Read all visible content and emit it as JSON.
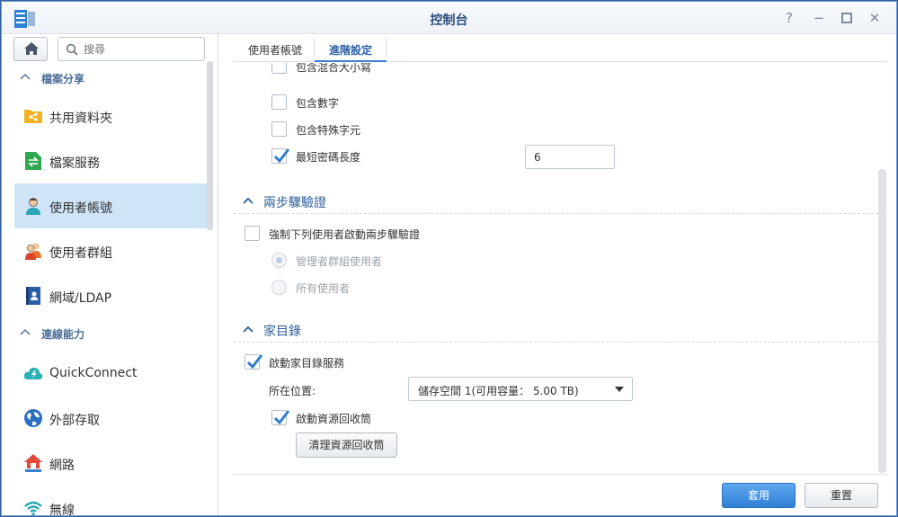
{
  "window": {
    "title": "控制台"
  },
  "controls": {
    "help": "?",
    "minimize": "−",
    "maximize": "□",
    "close": "✕"
  },
  "search": {
    "placeholder": "搜尋"
  },
  "sidebar": {
    "sections": [
      {
        "label": "檔案分享"
      },
      {
        "label": "連線能力"
      }
    ],
    "items": [
      {
        "label": "共用資料夾",
        "icon": "shared-folder-icon"
      },
      {
        "label": "檔案服務",
        "icon": "file-services-icon"
      },
      {
        "label": "使用者帳號",
        "icon": "user-icon"
      },
      {
        "label": "使用者群組",
        "icon": "group-icon"
      },
      {
        "label": "網域/LDAP",
        "icon": "domain-ldap-icon"
      },
      {
        "label": "QuickConnect",
        "icon": "quickconnect-icon"
      },
      {
        "label": "外部存取",
        "icon": "external-access-icon"
      },
      {
        "label": "網路",
        "icon": "network-icon"
      },
      {
        "label": "無線",
        "icon": "wireless-icon"
      }
    ],
    "active_item": "使用者帳號"
  },
  "tabs": [
    {
      "label": "使用者帳號"
    },
    {
      "label": "進階設定"
    }
  ],
  "active_tab": "進階設定",
  "password_rules": {
    "mixed_case": {
      "label": "包含混合大小寫",
      "checked": false
    },
    "numbers": {
      "label": "包含數字",
      "checked": false
    },
    "special_chars": {
      "label": "包含特殊字元",
      "checked": false
    },
    "min_length": {
      "label": "最短密碼長度",
      "checked": true,
      "value": "6"
    }
  },
  "two_step": {
    "title": "兩步驟驗證",
    "enforce": {
      "label": "強制下列使用者啟動兩步驟驗證",
      "checked": false
    },
    "options": [
      {
        "label": "管理者群組使用者",
        "selected": true
      },
      {
        "label": "所有使用者",
        "selected": false
      }
    ]
  },
  "home": {
    "title": "家目錄",
    "enable": {
      "label": "啟動家目錄服務",
      "checked": true
    },
    "location_label": "所在位置:",
    "location_value": "儲存空間 1(可用容量： 5.00 TB)",
    "recycle": {
      "label": "啟動資源回收筒",
      "checked": true
    },
    "empty_recycle_label": "清理資源回收筒"
  },
  "footer": {
    "apply_label": "套用",
    "reset_label": "重置"
  },
  "colors": {
    "accent": "#2f7fd6",
    "active_item_bg": "#cfe4f7",
    "section_title": "#2d5d9b"
  }
}
